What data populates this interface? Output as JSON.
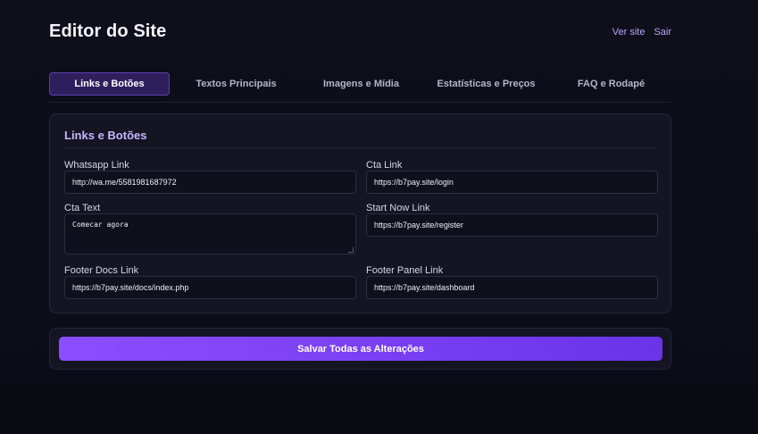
{
  "header": {
    "title": "Editor do Site",
    "links": [
      {
        "label": "Ver site"
      },
      {
        "label": "Sair"
      }
    ]
  },
  "tabs": [
    {
      "label": "Links e Botões",
      "active": true
    },
    {
      "label": "Textos Principais",
      "active": false
    },
    {
      "label": "Imagens e Mídia",
      "active": false
    },
    {
      "label": "Estatísticas e Preços",
      "active": false
    },
    {
      "label": "FAQ e Rodapé",
      "active": false
    }
  ],
  "card": {
    "title": "Links e Botões",
    "fields": {
      "whatsapp_link": {
        "label": "Whatsapp Link",
        "value": "http://wa.me/5581981687972"
      },
      "cta_link": {
        "label": "Cta Link",
        "value": "https://b7pay.site/login"
      },
      "cta_text": {
        "label": "Cta Text",
        "value": "Comecar agora"
      },
      "start_now_link": {
        "label": "Start Now Link",
        "value": "https://b7pay.site/register"
      },
      "footer_docs_link": {
        "label": "Footer Docs Link",
        "value": "https://b7pay.site/docs/index.php"
      },
      "footer_panel_link": {
        "label": "Footer Panel Link",
        "value": "https://b7pay.site/dashboard"
      }
    }
  },
  "save": {
    "label": "Salvar Todas as Alterações"
  },
  "colors": {
    "accent": "#8b4dff",
    "background": "#0f0f1c",
    "card": "#141423",
    "link": "#b9a6f5"
  }
}
